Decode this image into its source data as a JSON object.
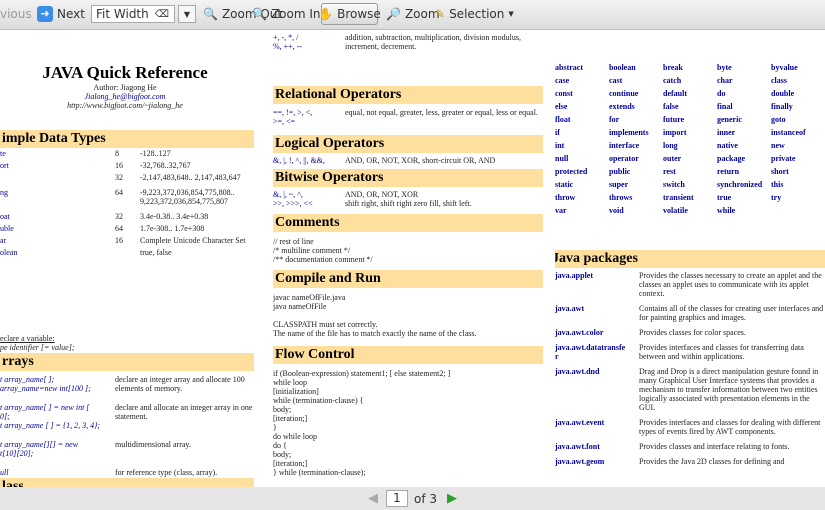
{
  "toolbar": {
    "previous": "vious",
    "next": "Next",
    "fit": "Fit Width",
    "zoom_out": "Zoom Out",
    "zoom_in": "Zoom In",
    "browse": "Browse",
    "zoom": "Zoom",
    "selection": "Selection"
  },
  "pager": {
    "current": "1",
    "of": "of 3"
  },
  "title": {
    "main": "JAVA Quick Reference",
    "author": "Author: Jiagong He",
    "email": "Jialong_he@bigfoot.com",
    "url": "http://www.bigfoot.com/~jialong_he"
  },
  "simple": {
    "header": "imple Data Types",
    "rows": [
      {
        "name": "te",
        "bits": "8",
        "range": "-128..127"
      },
      {
        "name": "ort",
        "bits": "16",
        "range": "-32,768..32,767"
      },
      {
        "name": "",
        "bits": "32",
        "range": "-2,147,483,648.. 2,147,483,647"
      },
      {
        "name": "ng",
        "bits": "64",
        "range": "-9,223,372,036,854,775,808.. 9,223,372,036,854,775,807"
      },
      {
        "name": "oat",
        "bits": "32",
        "range": "3.4e-0.38.. 3.4e+0.38"
      },
      {
        "name": "uble",
        "bits": "64",
        "range": "1.7e-308.. 1.7e+308"
      },
      {
        "name": "ar",
        "bits": "16",
        "range": "Complete Unicode Character Set"
      },
      {
        "name": "olean",
        "bits": "",
        "range": "true, false"
      }
    ],
    "declare1": "eclare a variable:",
    "declare2": "pe identifier [= value];"
  },
  "arrays": {
    "header": "rrays",
    "rows": [
      {
        "code": "t array_name[ ];\narray_name=new int[100 ];",
        "desc": "declare an integer array and allocate 100 elements of memory."
      },
      {
        "code": "t array_name[ ] = new int [\n0];\nt array_name [ ] = {1, 2, 3, 4};",
        "desc": "declare and allocate an integer array in one statement."
      },
      {
        "code": "t array_name[][] = new\nt[10][20];",
        "desc": "multidimensional array."
      },
      {
        "code": "ull",
        "desc": "for reference type (class, array)."
      }
    ]
  },
  "class_header": "lass",
  "operators": {
    "arith_sym": "+, -, *, /\n%, ++, --",
    "arith_desc": "addition, subtraction, multiplication, division modulus, increment, decrement.",
    "rel_header": "Relational Operators",
    "rel_sym": "==, !=, >, <,\n>=, <=",
    "rel_desc": "equal, not equal, greater, less, greater or equal, less or equal.",
    "log_header": "Logical Operators",
    "log_sym": "&, |, !, ^, ||, &&,",
    "log_desc": "AND, OR, NOT, XOR, short-circuit OR, AND",
    "bit_header": "Bitwise Operators",
    "bit_sym": "&, |, ~, ^,\n>>, >>>, <<",
    "bit_desc": "AND, OR, NOT, XOR\nshift right, shift right zero fill, shift left."
  },
  "comments": {
    "header": "Comments",
    "text": "// rest of line\n/* multiline comment */\n/** documentation comment */"
  },
  "compile": {
    "header": "Compile and Run",
    "text": "javac nameOfFile.java\njava nameOfFile\n\nCLASSPATH must set correctly.\nThe name of the file has to match exactly the name of the class."
  },
  "flow": {
    "header": "Flow Control",
    "text": "if (Boolean-expression) statement1; [ else statement2; ]\nwhile loop\n[initialization]\nwhile (termination-clause) {\nbody;\n[iteration;]\n}\ndo while loop\ndo {\nbody;\n[iteration;]\n} while (termination-clause);"
  },
  "keywords": [
    [
      "abstract",
      "boolean",
      "break",
      "byte",
      "byvalue"
    ],
    [
      "case",
      "cast",
      "catch",
      "char",
      "class"
    ],
    [
      "const",
      "continue",
      "default",
      "do",
      "double"
    ],
    [
      "else",
      "extends",
      "false",
      "final",
      "finally"
    ],
    [
      "float",
      "for",
      "future",
      "generic",
      "goto"
    ],
    [
      "if",
      "implements",
      "import",
      "inner",
      "instanceof"
    ],
    [
      "int",
      "interface",
      "long",
      "native",
      "new"
    ],
    [
      "null",
      "operator",
      "outer",
      "package",
      "private"
    ],
    [
      "protected",
      "public",
      "rest",
      "return",
      "short"
    ],
    [
      "static",
      "super",
      "switch",
      "synchronized",
      "this"
    ],
    [
      "throw",
      "throws",
      "transient",
      "true",
      "try"
    ],
    [
      "var",
      "void",
      "volatile",
      "while",
      ""
    ]
  ],
  "packages": {
    "header": "Java packages",
    "rows": [
      {
        "name": "java.applet",
        "desc": "Provides the classes necessary to create an applet and the classes an applet uses to communicate with its applet context."
      },
      {
        "name": "java.awt",
        "desc": "Contains all of the classes for creating user interfaces and for painting graphics and images."
      },
      {
        "name": "java.awt.color",
        "desc": "Provides classes for color spaces."
      },
      {
        "name": "java.awt.datatransfe\nr",
        "desc": "Provides interfaces and classes for transferring data between and within applications."
      },
      {
        "name": "java.awt.dnd",
        "desc": "Drag and Drop is a direct manipulation gesture found in many Graphical User Interface systems that provides a mechanism to transfer information between two entities logically associated with presentation elements in the GUI."
      },
      {
        "name": "java.awt.event",
        "desc": "Provides interfaces and classes for dealing with different types of events fired by AWT components."
      },
      {
        "name": "java.awt.font",
        "desc": "Provides classes and interface relating to fonts."
      },
      {
        "name": "java.awt.geom",
        "desc": "Provides the Java 2D classes for defining and"
      }
    ]
  }
}
